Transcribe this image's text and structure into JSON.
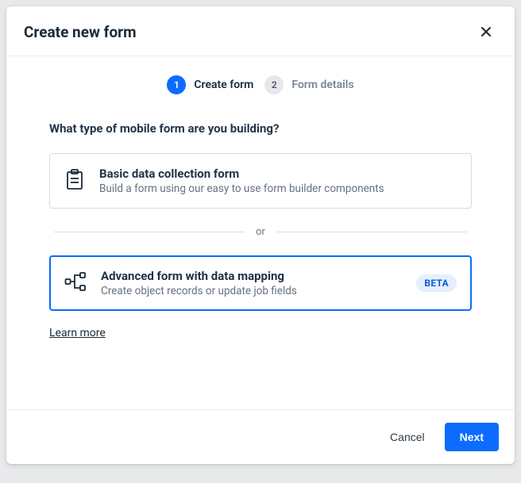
{
  "modal": {
    "title": "Create new form"
  },
  "stepper": {
    "steps": [
      {
        "num": "1",
        "label": "Create form"
      },
      {
        "num": "2",
        "label": "Form details"
      }
    ]
  },
  "question": "What type of mobile form are you building?",
  "options": {
    "basic": {
      "title": "Basic data collection form",
      "subtitle": "Build a form using our easy to use form builder components"
    },
    "advanced": {
      "title": "Advanced form with data mapping",
      "subtitle": "Create object records or update job fields",
      "badge": "BETA"
    }
  },
  "divider": "or",
  "learn_more": "Learn more",
  "footer": {
    "cancel": "Cancel",
    "next": "Next"
  }
}
